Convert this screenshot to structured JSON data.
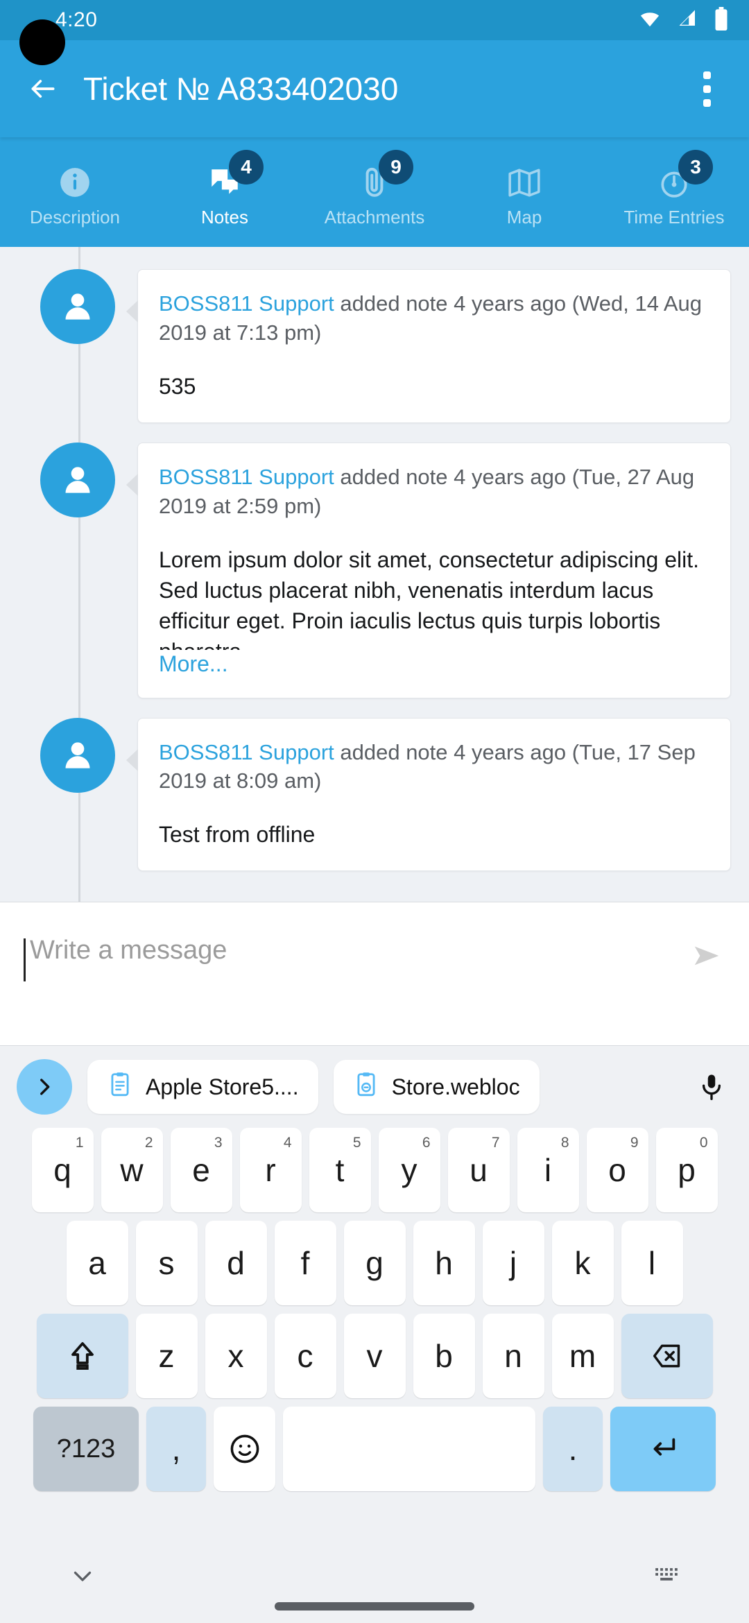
{
  "status_bar": {
    "time": "4:20",
    "icons": [
      "wifi-icon",
      "cellular-signal-icon",
      "battery-icon"
    ]
  },
  "app_bar": {
    "back_icon": "back-arrow-icon",
    "title": "Ticket № A833402030",
    "overflow_icon": "overflow-menu-icon"
  },
  "tabs": [
    {
      "label": "Description",
      "icon": "info-icon",
      "badge": "",
      "active": false
    },
    {
      "label": "Notes",
      "icon": "notes-icon",
      "badge": "4",
      "active": true
    },
    {
      "label": "Attachments",
      "icon": "paperclip-icon",
      "badge": "9",
      "active": false
    },
    {
      "label": "Map",
      "icon": "map-icon",
      "badge": "",
      "active": false
    },
    {
      "label": "Time Entries",
      "icon": "stopwatch-icon",
      "badge": "3",
      "active": false
    }
  ],
  "notes": [
    {
      "author": "BOSS811 Support",
      "meta": " added note 4 years ago (Wed, 14 Aug 2019 at 7:13 pm)",
      "body": "535",
      "more_label": "",
      "clipped": false
    },
    {
      "author": "BOSS811 Support",
      "meta": " added note 4 years ago (Tue, 27 Aug 2019 at 2:59 pm)",
      "body": "Lorem ipsum dolor sit amet, consectetur adipiscing elit. Sed luctus placerat nibh, venenatis interdum lacus efficitur eget. Proin iaculis lectus quis turpis lobortis pharetra.",
      "more_label": "More...",
      "clipped": true
    },
    {
      "author": "BOSS811 Support",
      "meta": " added note 4 years ago (Tue, 17 Sep 2019 at 8:09 am)",
      "body": "Test from offline",
      "more_label": "",
      "clipped": false
    }
  ],
  "composer": {
    "placeholder": "Write a message",
    "value": "",
    "send_icon": "send-icon"
  },
  "keyboard": {
    "expand_icon": "chevron-right-icon",
    "suggestions": [
      {
        "icon": "clipboard-icon",
        "label": "Apple Store5...."
      },
      {
        "icon": "clipboard-link-icon",
        "label": "Store.webloc"
      }
    ],
    "mic_icon": "microphone-icon",
    "row1": [
      {
        "key": "q",
        "sup": "1"
      },
      {
        "key": "w",
        "sup": "2"
      },
      {
        "key": "e",
        "sup": "3"
      },
      {
        "key": "r",
        "sup": "4"
      },
      {
        "key": "t",
        "sup": "5"
      },
      {
        "key": "y",
        "sup": "6"
      },
      {
        "key": "u",
        "sup": "7"
      },
      {
        "key": "i",
        "sup": "8"
      },
      {
        "key": "o",
        "sup": "9"
      },
      {
        "key": "p",
        "sup": "0"
      }
    ],
    "row2": [
      {
        "key": "a"
      },
      {
        "key": "s"
      },
      {
        "key": "d"
      },
      {
        "key": "f"
      },
      {
        "key": "g"
      },
      {
        "key": "h"
      },
      {
        "key": "j"
      },
      {
        "key": "k"
      },
      {
        "key": "l"
      }
    ],
    "row3": [
      {
        "key": "z"
      },
      {
        "key": "x"
      },
      {
        "key": "c"
      },
      {
        "key": "v"
      },
      {
        "key": "b"
      },
      {
        "key": "n"
      },
      {
        "key": "m"
      }
    ],
    "shift_icon": "shift-icon",
    "backspace_icon": "backspace-icon",
    "symbols_label": "?123",
    "comma_label": ",",
    "emoji_icon": "emoji-icon",
    "space_label": "",
    "period_label": ".",
    "enter_icon": "enter-icon"
  },
  "nav_bar": {
    "down_icon": "chevron-down-icon",
    "home_indicator": "home-indicator",
    "keyboard_icon": "keyboard-toggle-icon"
  },
  "colors": {
    "brand": "#2ba2dd",
    "status_bar": "#1f93c8",
    "badge": "#0f4c75",
    "link": "#2ba2dd",
    "page_bg": "#eef1f5",
    "key_accent": "#cfe2f1",
    "enter_key": "#7ecbf7"
  }
}
